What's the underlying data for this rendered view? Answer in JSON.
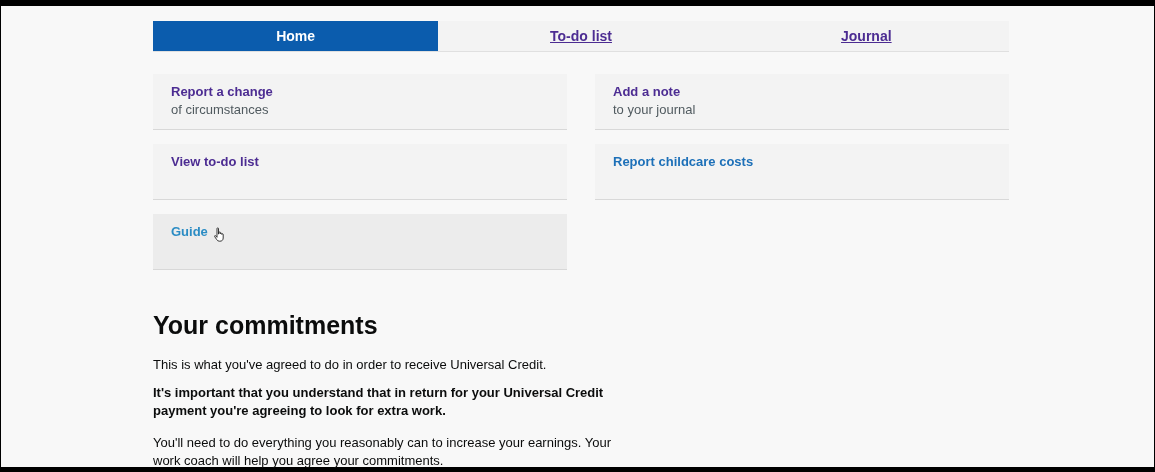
{
  "tabs": [
    {
      "label": "Home",
      "selected": true
    },
    {
      "label": "To-do list",
      "selected": false
    },
    {
      "label": "Journal",
      "selected": false
    }
  ],
  "cards": [
    {
      "title": "Report a change",
      "subtitle": "of circumstances",
      "visited": true,
      "hovered": false
    },
    {
      "title": "Add a note",
      "subtitle": "to your journal",
      "visited": true,
      "hovered": false
    },
    {
      "title": "View to-do list",
      "visited": true,
      "hovered": false
    },
    {
      "title": "Report childcare costs",
      "visited": false,
      "hovered": false
    },
    {
      "title": "Guide",
      "visited": false,
      "hovered": true
    }
  ],
  "commitments": {
    "heading": "Your commitments",
    "intro": "This is what you've agreed to do in order to receive Universal Credit.",
    "important": "It's important that you understand that in return for your Universal Credit payment you're agreeing to look for extra work.",
    "body": "You'll need to do everything you reasonably can to increase your earnings. Your work coach will help you agree your commitments."
  }
}
